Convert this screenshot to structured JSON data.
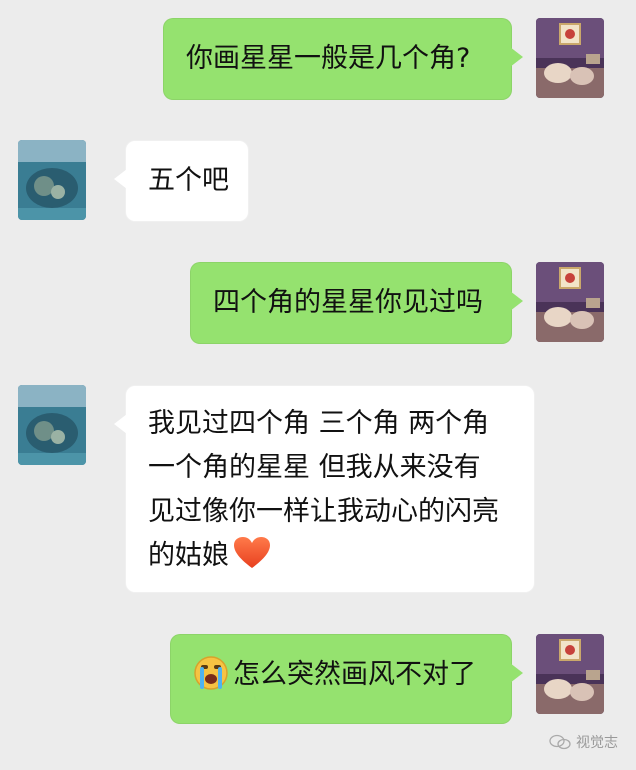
{
  "messages": [
    {
      "side": "me",
      "text": "你画星星一般是几个角?"
    },
    {
      "side": "other",
      "text": "五个吧"
    },
    {
      "side": "me",
      "text": "四个角的星星你见过吗"
    },
    {
      "side": "other",
      "lines": [
        "我见过四个角 三个角 两个角",
        "一个角的星星 但我从来没有",
        "见过像你一样让我动心的闪亮",
        "的姑娘"
      ],
      "emoji": "heart-icon"
    },
    {
      "side": "me",
      "text": "怎么突然画风不对了",
      "emoji": "crying-face-icon"
    }
  ],
  "watermark": {
    "text": "视觉志",
    "icon": "wechat-official-account-icon"
  },
  "colors": {
    "my_bubble": "#95e26f",
    "other_bubble": "#ffffff",
    "background": "#ececec"
  }
}
